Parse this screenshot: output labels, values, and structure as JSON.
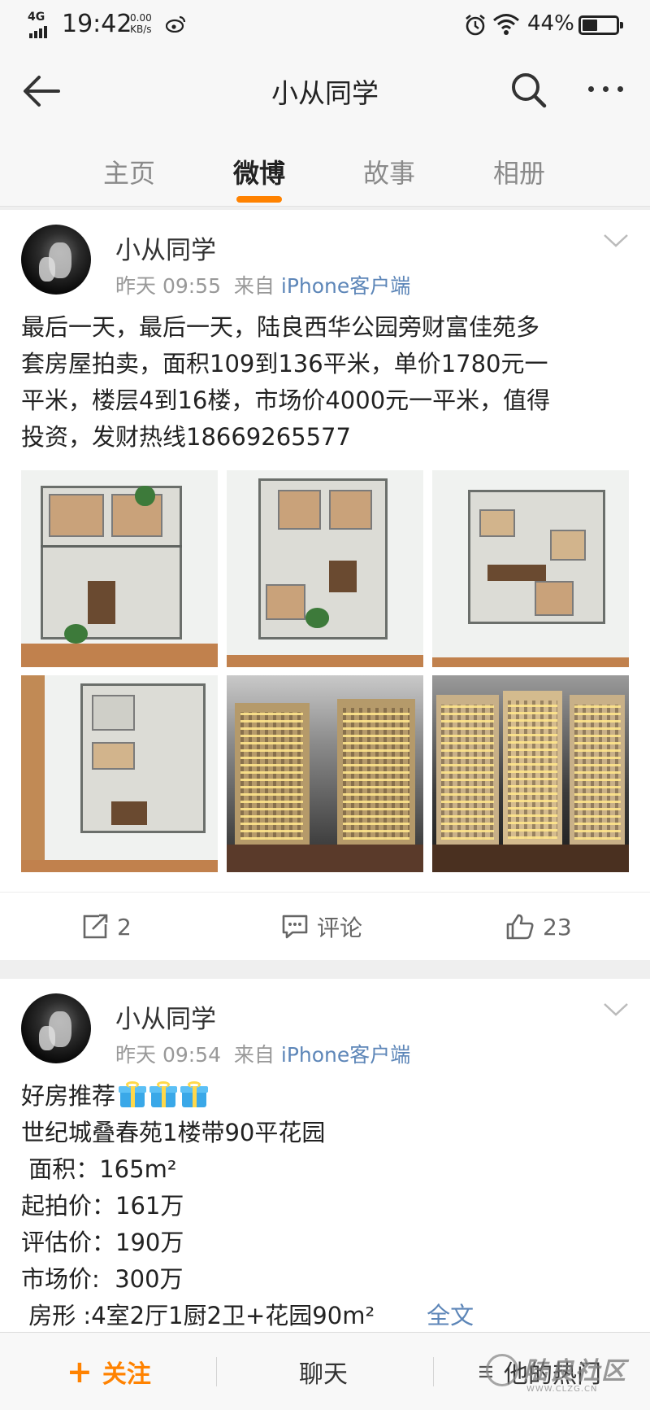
{
  "status_bar": {
    "network": "4G",
    "time": "19:42",
    "speed_value": "0.00",
    "speed_unit": "KB/s",
    "battery": "44%",
    "battery_level": 0.44
  },
  "header": {
    "title": "小从同学"
  },
  "tabs": [
    {
      "label": "主页",
      "active": false
    },
    {
      "label": "微博",
      "active": true
    },
    {
      "label": "故事",
      "active": false
    },
    {
      "label": "相册",
      "active": false
    }
  ],
  "accent_color": "#ff8200",
  "link_color": "#5d86b8",
  "posts": [
    {
      "user": "小从同学",
      "time": "昨天 09:55",
      "from": "来自",
      "source": "iPhone客户端",
      "text": "最后一天，最后一天，陆良西华公园旁财富佳苑多\n套房屋拍卖，面积109到136平米，单价1780元一\n平米，楼层4到16楼，市场价4000元一平米，值得\n投资，发财热线18669265577",
      "images": [
        "floor-plan-model",
        "floor-plan-model",
        "floor-plan-model",
        "floor-plan-model",
        "building-model-night",
        "building-model-night"
      ],
      "reposts": "2",
      "comments_label": "评论",
      "likes": "23"
    },
    {
      "user": "小从同学",
      "time": "昨天 09:54",
      "from": "来自",
      "source": "iPhone客户端",
      "lines": [
        "好房推荐",
        "世纪城叠春苑1楼带90平花园",
        " 面积：165m²",
        "起拍价：161万",
        "评估价：190万",
        "市场价:  300万",
        " 房形 :4室2厅1厨2卫+花园90m²"
      ],
      "more_label": "全文"
    }
  ],
  "bottom_bar": {
    "follow": "关注",
    "chat": "聊天",
    "hot": "他的热门"
  },
  "watermark": {
    "text": "陆良社区",
    "url": "WWW.CLZG.CN"
  }
}
